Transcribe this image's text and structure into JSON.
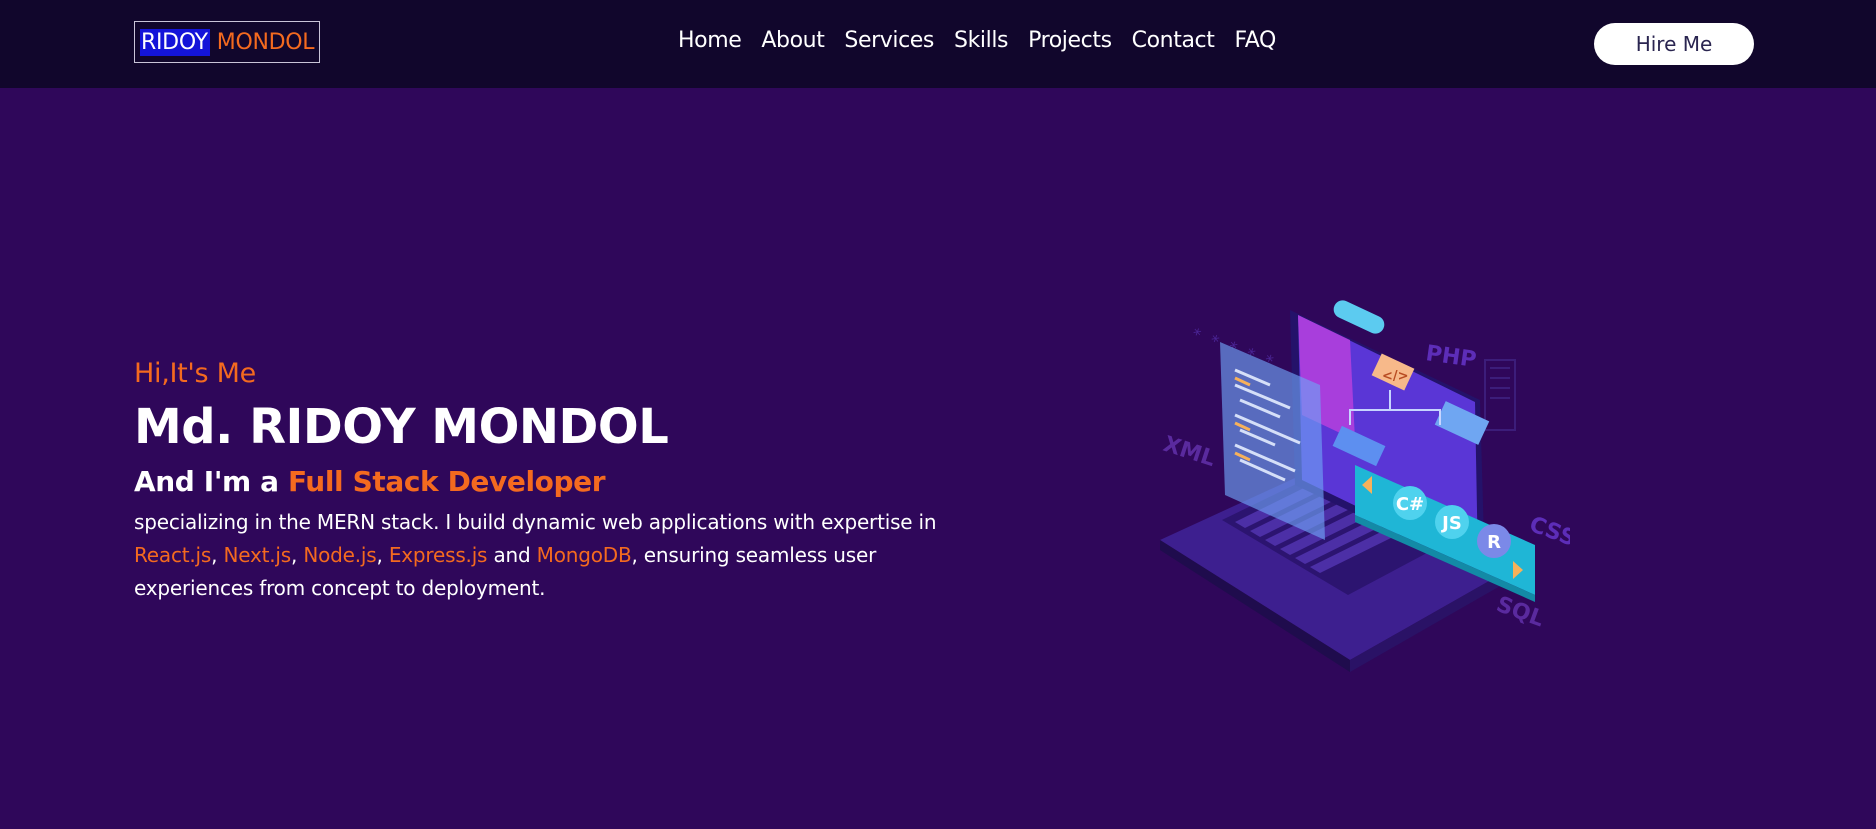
{
  "brand": {
    "first": "RIDOY",
    "second": "MONDOL"
  },
  "nav": {
    "items": [
      "Home",
      "About",
      "Services",
      "Skills",
      "Projects",
      "Contact",
      "FAQ"
    ],
    "cta": "Hire Me"
  },
  "hero": {
    "greeting": "Hi,It's Me",
    "name": "Md. RIDOY MONDOL",
    "role_prefix": "And I'm a",
    "role": "Full Stack Developer",
    "desc_part1": "specializing in the MERN stack. I build dynamic web applications with expertise in",
    "techs": [
      "React.js",
      "Next.js",
      "Node.js",
      "Express.js",
      "MongoDB"
    ],
    "sep_comma": ",",
    "sep_and": "and",
    "desc_part2": ", ensuring seamless user experiences from concept to deployment."
  },
  "illustration": {
    "badges": [
      "C#",
      "JS",
      "R"
    ],
    "floating_labels": [
      "PHP",
      "XML",
      "CSS",
      "SQL"
    ],
    "code_tag": "</>"
  },
  "colors": {
    "background": "#2f075a",
    "navbar": "#11062c",
    "accent": "#f46a1f",
    "logo_highlight": "#1414d9"
  }
}
